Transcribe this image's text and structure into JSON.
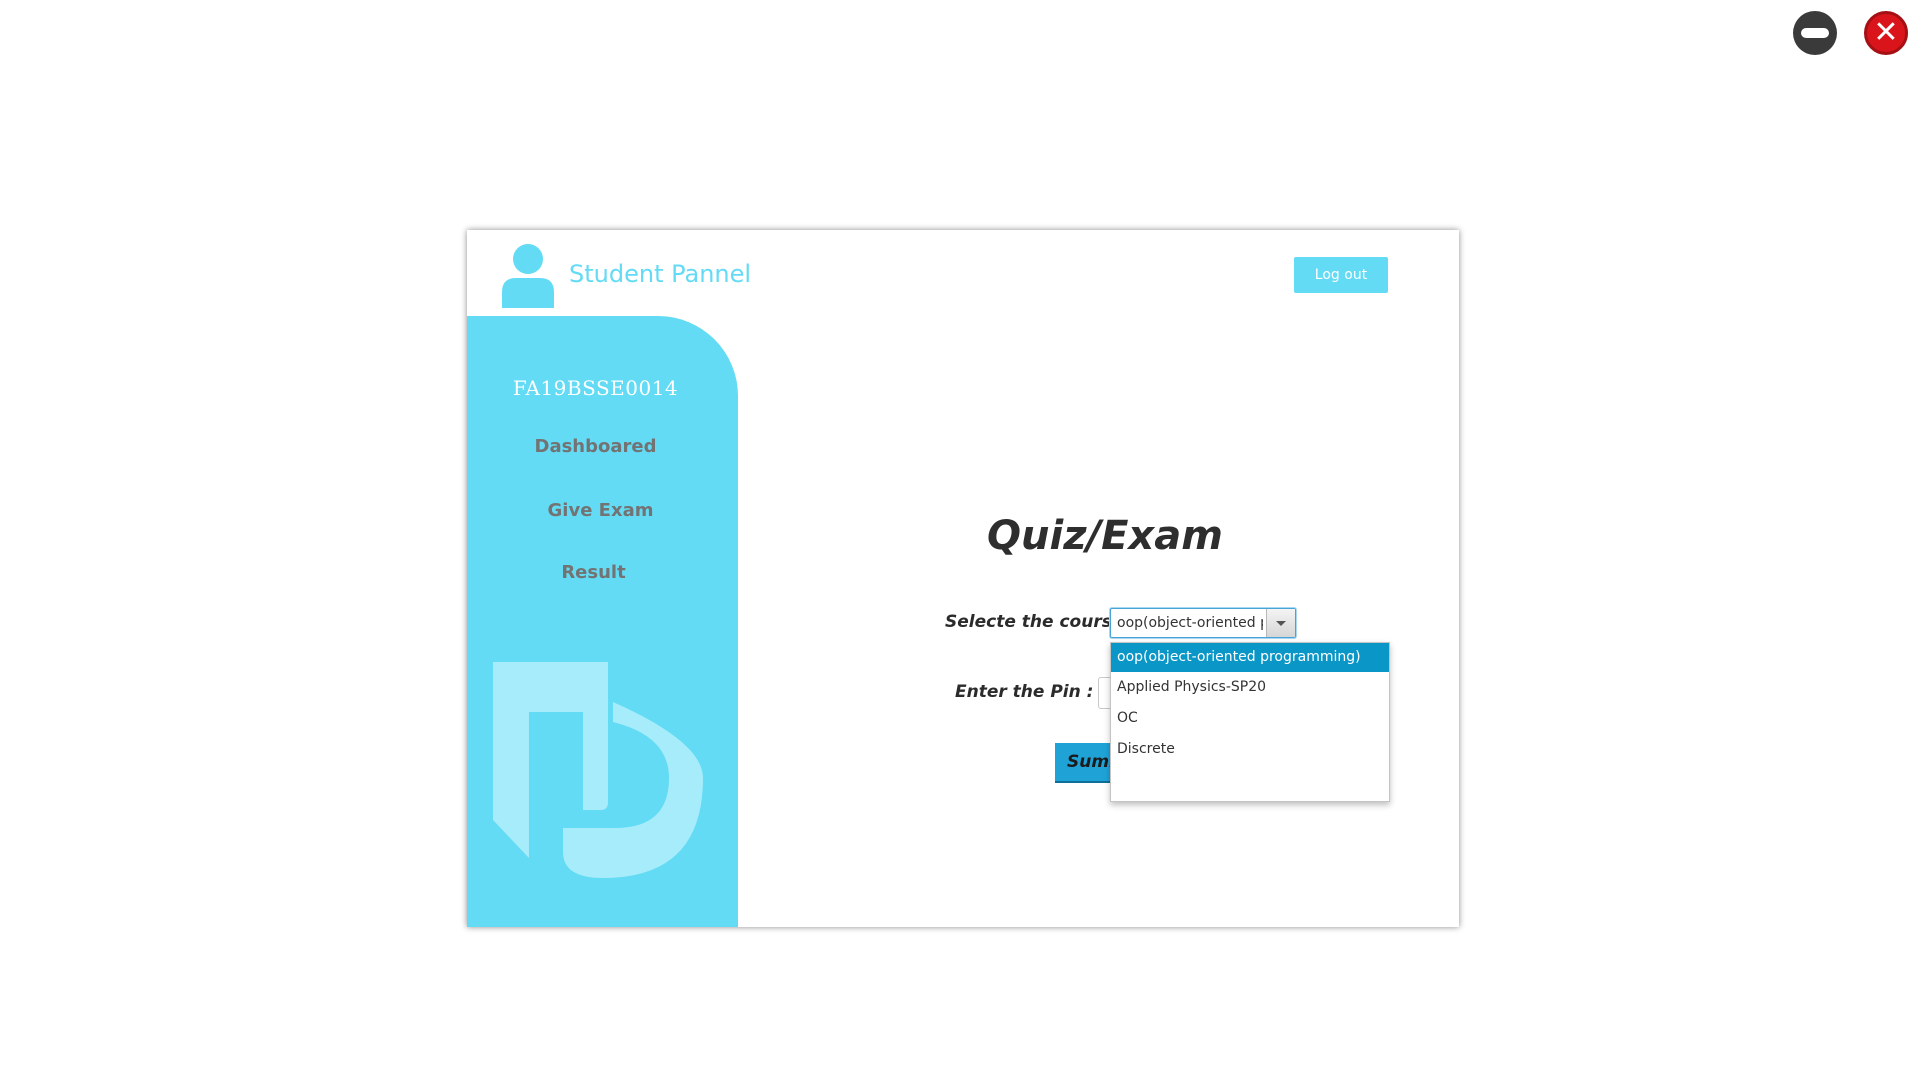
{
  "window_controls": {
    "minimize_icon": "minimize-icon",
    "close_icon": "close-icon",
    "close_glyph": "✕"
  },
  "header": {
    "title": "Student Pannel",
    "logout_label": "Log out",
    "avatar_icon": "user-avatar-icon"
  },
  "sidebar": {
    "student_id": "FA19BSSE0014",
    "items": [
      {
        "label": "Dashboared"
      },
      {
        "label": "Give Exam"
      },
      {
        "label": "Result"
      }
    ],
    "logo_icon": "fj-logo-icon"
  },
  "main": {
    "title": "Quiz/Exam",
    "course_label": "Selecte the course",
    "course_selected": "oop(object-oriented programming)",
    "pin_label": "Enter the Pin :",
    "pin_value": "",
    "submit_label": "Sumbit"
  },
  "dropdown": {
    "options": [
      {
        "label": "oop(object-oriented programming)",
        "selected": true
      },
      {
        "label": "Applied Physics-SP20",
        "selected": false
      },
      {
        "label": "OC",
        "selected": false
      },
      {
        "label": "Discrete",
        "selected": false
      }
    ]
  },
  "colors": {
    "accent": "#63dbf5",
    "submit": "#1fa3d7",
    "selection": "#0a96c6",
    "nav_text": "#737373",
    "close_button": "#d9141b"
  }
}
